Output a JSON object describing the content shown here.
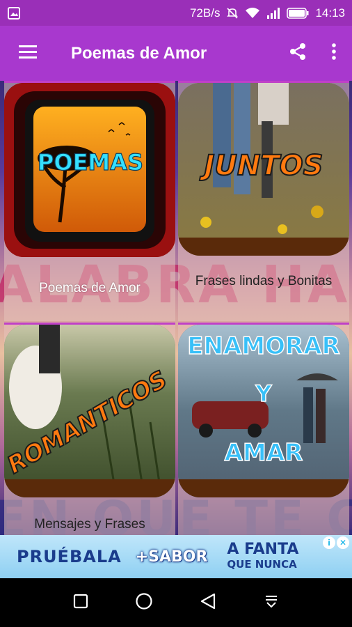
{
  "status_bar": {
    "network_speed": "72B/s",
    "time": "14:13",
    "icons": [
      "gallery-icon",
      "mute-icon",
      "wifi-icon",
      "signal-icon",
      "battery-icon"
    ]
  },
  "app_bar": {
    "title": "Poemas de Amor",
    "icons": [
      "menu-icon",
      "share-icon",
      "more-vert-icon"
    ]
  },
  "cards": [
    {
      "label": "Poemas de Amor",
      "art_text": "POEMAS"
    },
    {
      "label": "Frases lindas y Bonitas",
      "art_text": "JUNTOS"
    },
    {
      "label": "Mensajes y Frases",
      "art_text": "ROMANTICOS"
    },
    {
      "label": "",
      "art_text_top": "ENAMORAR",
      "art_text_mid": "Y",
      "art_text_bottom": "AMAR"
    }
  ],
  "background_words": [
    "ALABRA HASTA",
    "EN QUE TE CON"
  ],
  "ad": {
    "text1": "PRUÉBALA",
    "text2": "+SABOR",
    "text3_a": "A FANTA",
    "text3_b": "QUE NUNCA"
  },
  "nav_bar": {
    "icons": [
      "recents-square-icon",
      "home-circle-icon",
      "back-triangle-icon",
      "notification-pull-icon"
    ]
  },
  "colors": {
    "status_bar": "#9a2fb8",
    "app_bar": "#a838ce",
    "ad_background": "#8fd0f2",
    "nav_bar": "#000000"
  }
}
